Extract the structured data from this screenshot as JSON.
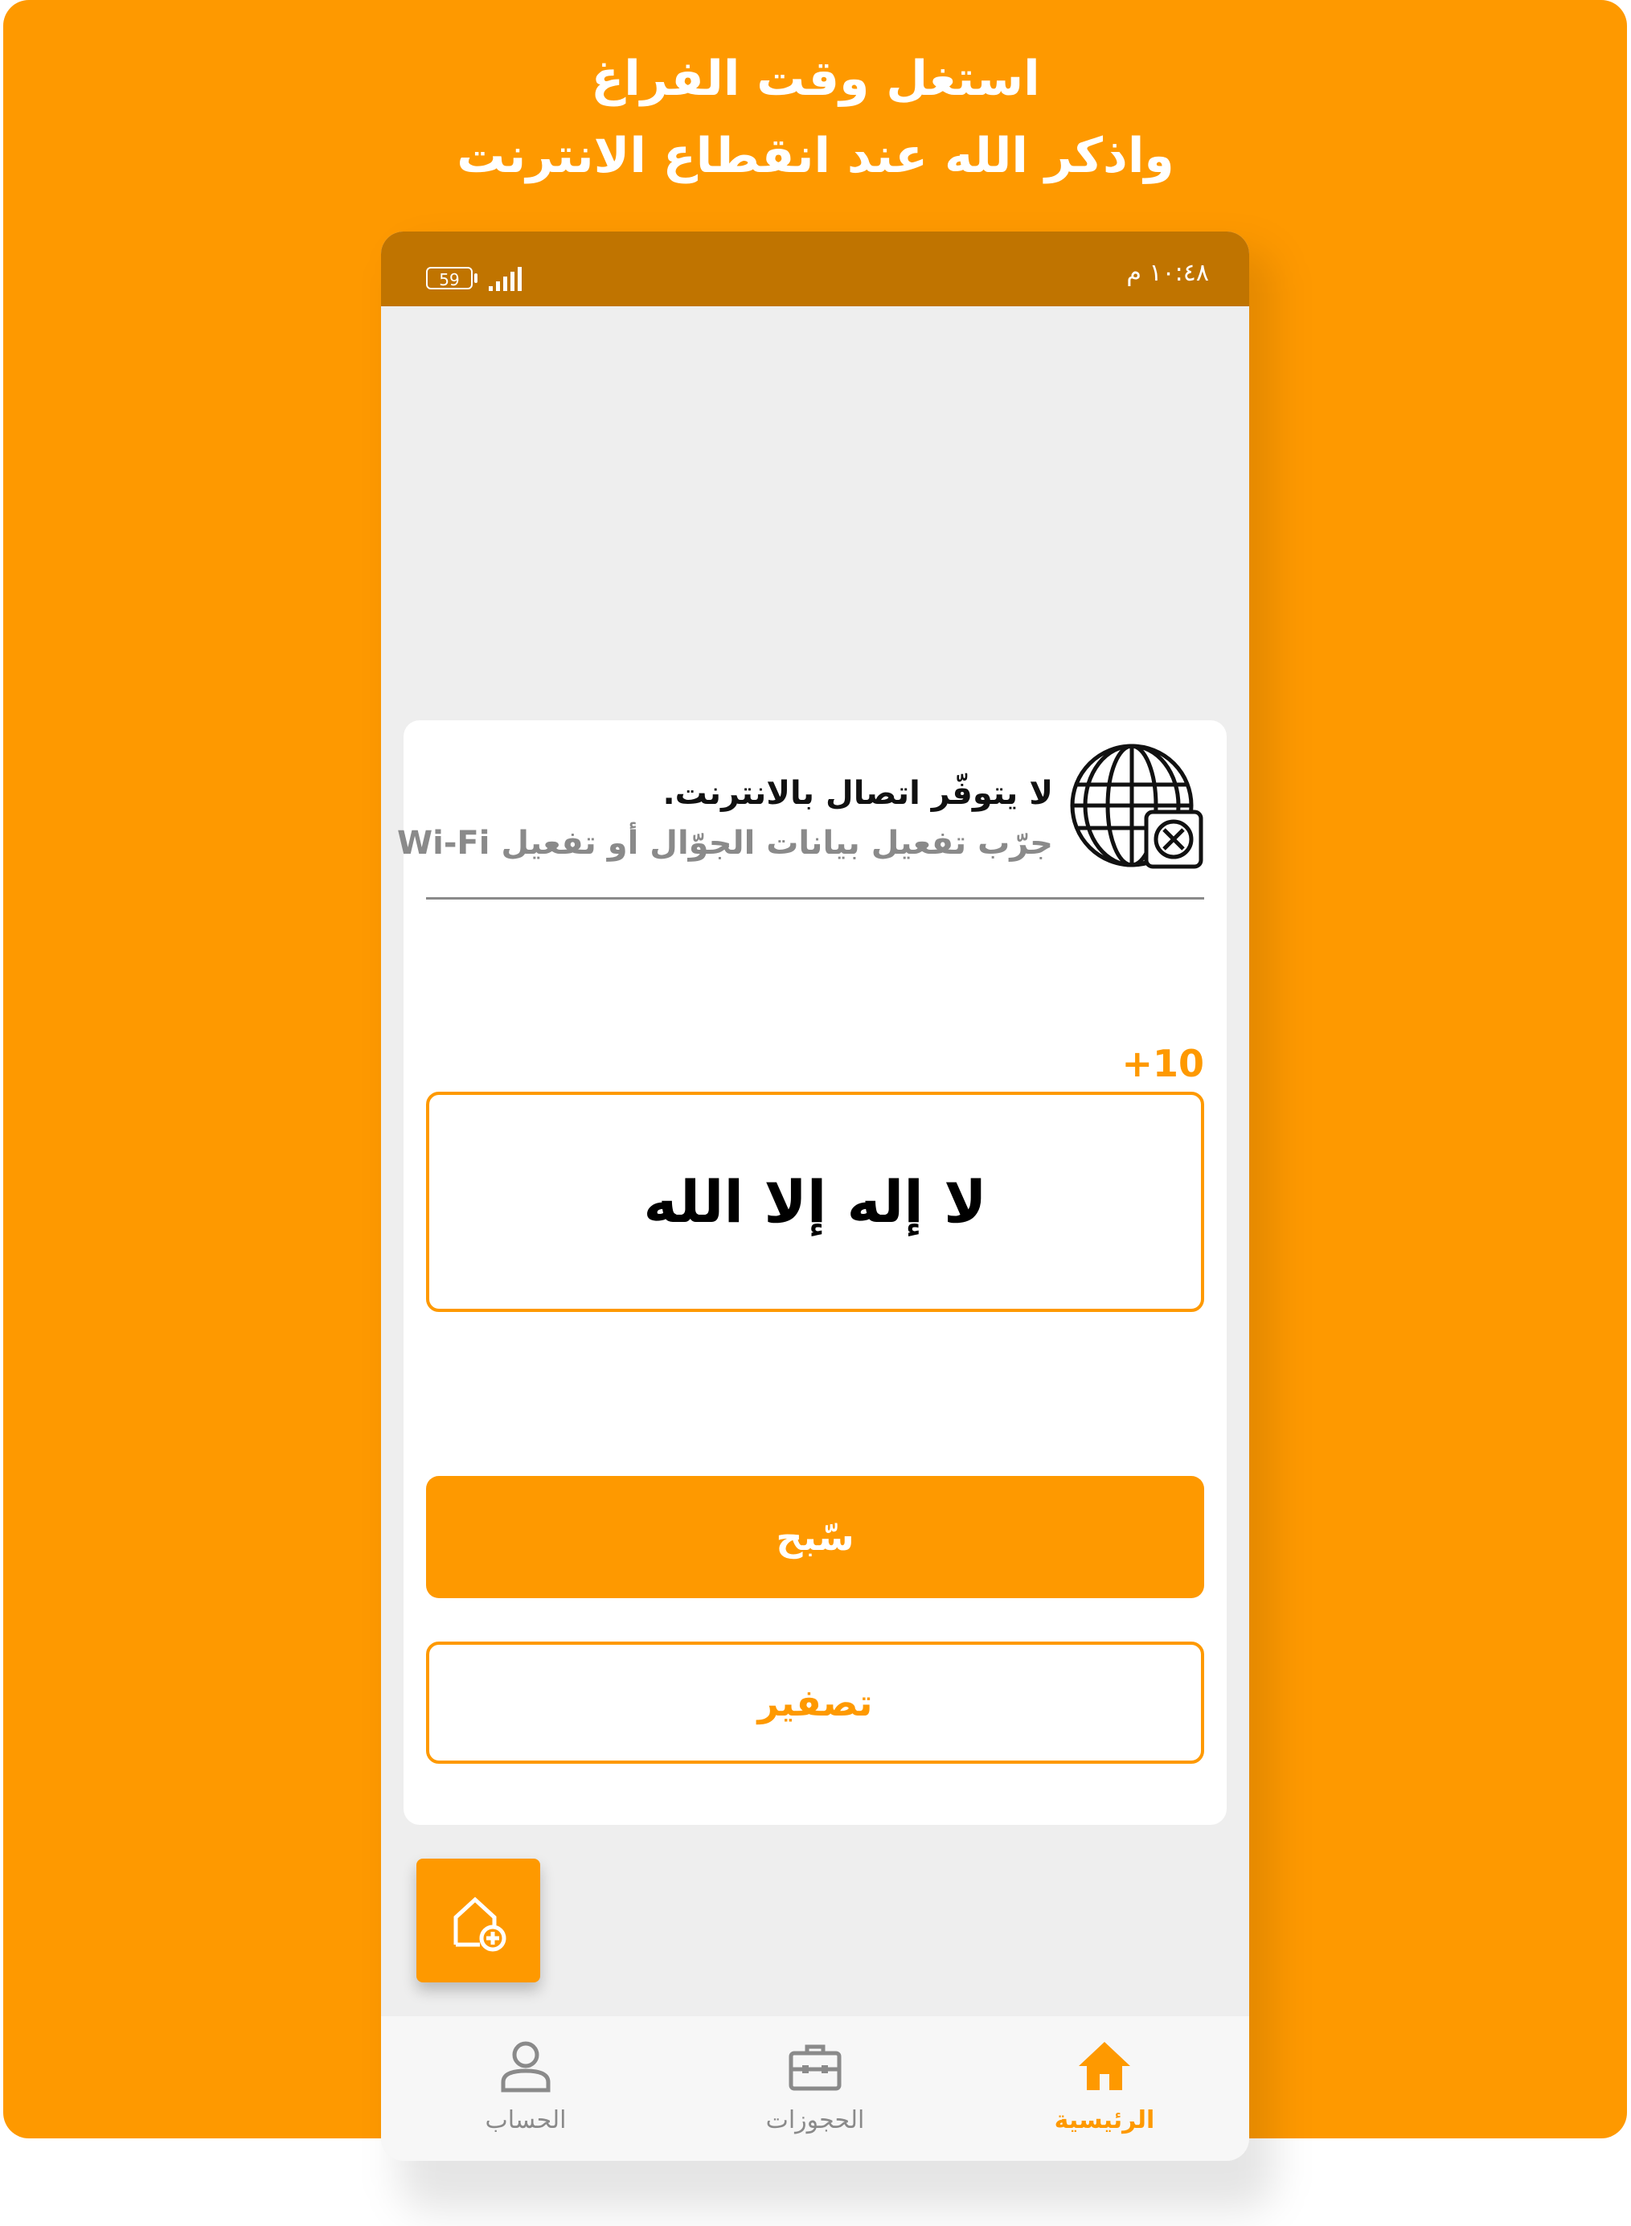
{
  "headline": {
    "line1": "استغل وقت الفراغ",
    "line2": "واذكر الله عند انقطاع الانترنت"
  },
  "status_bar": {
    "time": "١٠:٤٨ م",
    "battery": "59"
  },
  "offline_notice": {
    "title": "لا يتوفّر اتصال بالانترنت.",
    "subtitle": "جرّب تفعيل بيانات الجوّال أو تفعيل Wi-Fi",
    "icon": "globe-offline-icon"
  },
  "tasbih": {
    "increment": "+10",
    "dhikr": "لا إله إلا الله",
    "tasbih_button": "سّبح",
    "reset_button": "تصفير"
  },
  "fab": {
    "icon": "add-home-icon"
  },
  "bottom_nav": {
    "items": [
      {
        "label": "الرئيسية",
        "icon": "home-icon",
        "active": true
      },
      {
        "label": "الحجوزات",
        "icon": "briefcase-icon",
        "active": false
      },
      {
        "label": "الحساب",
        "icon": "user-icon",
        "active": false
      }
    ]
  },
  "colors": {
    "accent": "#FE9900",
    "status_bar": "#C07400",
    "inactive": "#8A8A8A"
  }
}
